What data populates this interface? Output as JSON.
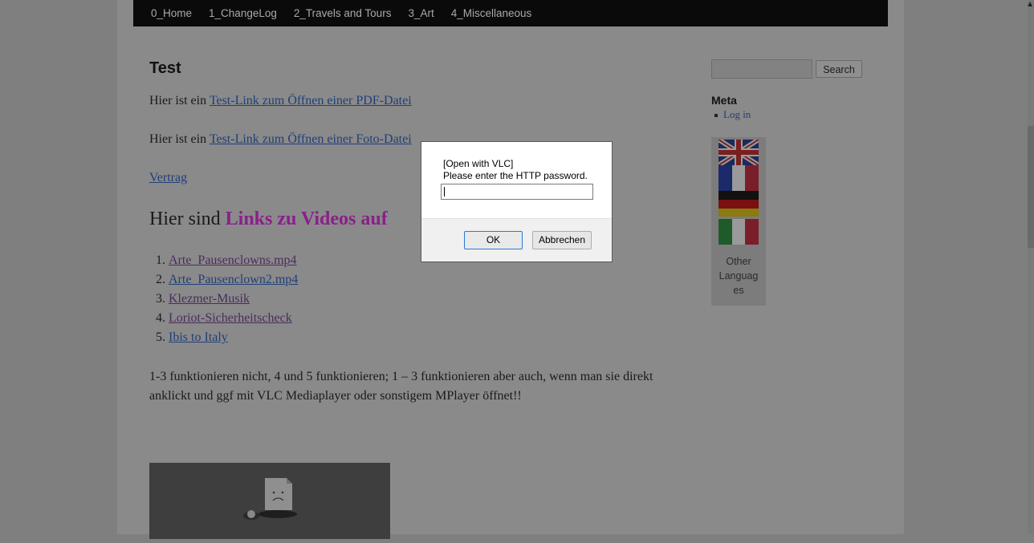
{
  "nav": {
    "items": [
      "0_Home",
      "1_ChangeLog",
      "2_Travels and Tours",
      "3_Art",
      "4_Miscellaneous"
    ]
  },
  "post": {
    "title": "Test",
    "p1_prefix": "Hier ist ein ",
    "p1_link": "Test-Link zum Öffnen einer PDF-Datei",
    "p2_prefix": "Hier ist ein ",
    "p2_link": "Test-Link zum Öffnen einer Foto-Datei",
    "vertrag_link": "Vertrag",
    "heading_prefix": "Hier sind ",
    "heading_colored": "Links zu Videos auf",
    "videos": [
      "Arte_Pausenclowns.mp4",
      "Arte_Pausenclown2.mp4",
      "Klezmer-Musik",
      "Loriot-Sicherheitscheck",
      "Ibis to Italy"
    ],
    "note": "1-3 funktionieren nicht, 4 und 5 funktionieren; 1 – 3 funktionieren aber auch, wenn man sie direkt anklickt und ggf mit VLC Mediaplayer oder sonstigem MPlayer öffnet!!"
  },
  "sidebar": {
    "search_button": "Search",
    "meta_heading": "Meta",
    "login_link": "Log in",
    "other_languages_l1": "Other",
    "other_languages_l2": "Languag",
    "other_languages_l3": "es",
    "flags": [
      "uk-flag-icon",
      "france-flag-icon",
      "germany-flag-icon",
      "italy-flag-icon"
    ]
  },
  "dialog": {
    "line1": "[Open with VLC]",
    "line2": "Please enter the HTTP password.",
    "password_value": "",
    "ok_label": "OK",
    "cancel_label": "Abbrechen"
  },
  "colors": {
    "overlay": "#7f7f7f",
    "nav_bg": "#0a0a0a",
    "heading_accent": "#8b1f8b",
    "link": "#1f3f78"
  }
}
